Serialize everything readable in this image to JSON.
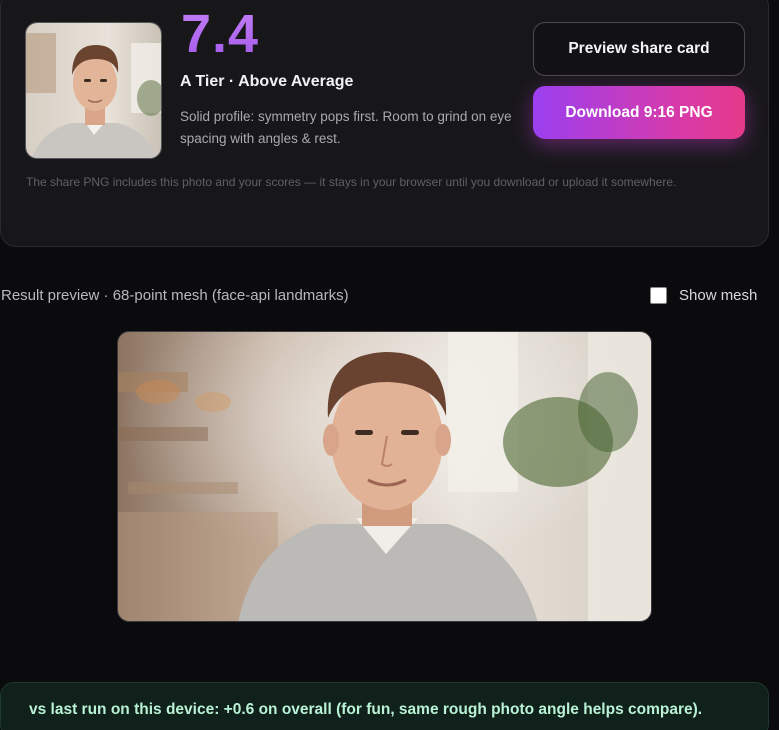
{
  "score_card": {
    "score": "7.4",
    "tier": "A Tier · Above Average",
    "description": "Solid profile: symmetry pops first. Room to grind on eye spacing with angles & rest.",
    "preview_button": "Preview share card",
    "download_button": "Download 9:16 PNG",
    "privacy_note": "The share PNG includes this photo and your scores — it stays in your browser until you download or upload it somewhere."
  },
  "preview": {
    "label": "Result preview · 68-point mesh (face-api landmarks)",
    "mesh_toggle_label": "Show mesh",
    "mesh_checked": false
  },
  "comparison": {
    "text": "vs last run on this device: +0.6 on overall (for fun, same rough photo angle helps compare)."
  },
  "colors": {
    "score_purple": "#b36bf2",
    "download_gradient_start": "#9b3ff0",
    "download_gradient_end": "#e53a8a",
    "compare_text": "#b9f2d4"
  }
}
